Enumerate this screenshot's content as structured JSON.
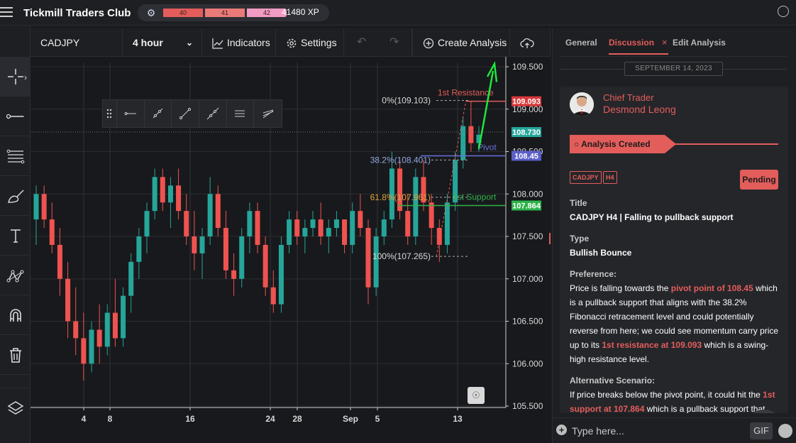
{
  "app": {
    "title": "Tickmill Traders Club",
    "xp_levels": [
      "40",
      "41",
      "42"
    ],
    "xp_total": "41480 XP"
  },
  "toolbar": {
    "symbol": "CADJPY",
    "interval": "4 hour",
    "indicators": "Indicators",
    "settings": "Settings",
    "create_analysis": "Create Analysis",
    "upload": "Up"
  },
  "left_tools": [
    "crosshair-icon",
    "trendline-icon",
    "fib-lines-icon",
    "brush-icon",
    "text-icon",
    "pattern-icon",
    "magnet-icon",
    "trash-icon",
    "layers-icon"
  ],
  "chart_data": {
    "type": "candlestick",
    "symbol": "CADJPY",
    "interval": "4 hour",
    "y_ticks": [
      "109.500",
      "109.000",
      "108.500",
      "108.000",
      "107.500",
      "107.000",
      "106.500",
      "106.000",
      "105.500"
    ],
    "ylim": [
      105.5,
      109.5
    ],
    "x_ticks": [
      "4",
      "8",
      "16",
      "24",
      "28",
      "Sep",
      "5",
      "13"
    ],
    "price_badges": [
      {
        "label": "109.093",
        "value": 109.093,
        "color": "#d9383a"
      },
      {
        "label": "108.730",
        "value": 108.73,
        "color": "#26a69a"
      },
      {
        "label": "108.45",
        "value": 108.45,
        "color": "#5b5fc7"
      },
      {
        "label": "107.864",
        "value": 107.864,
        "color": "#2db34a"
      }
    ],
    "annotations": {
      "resistance": {
        "label": "1st Resistance",
        "value": 109.093,
        "color": "#e35d5b"
      },
      "pivot": {
        "label": "Pivot",
        "value": 108.45,
        "color": "#6b6fe0"
      },
      "support": {
        "label": "1st Support",
        "value": 107.864,
        "color": "#2db34a"
      }
    },
    "fib_levels": [
      {
        "label": "0%(109.103)",
        "value": 109.103
      },
      {
        "label": "38.2%(108.401)",
        "value": 108.401
      },
      {
        "label": "61.8%(107.961)",
        "value": 107.961
      },
      {
        "label": "100%(107.265)",
        "value": 107.265
      }
    ],
    "candles": [
      {
        "o": 107.7,
        "h": 108.1,
        "l": 107.4,
        "c": 108.0
      },
      {
        "o": 108.0,
        "h": 108.1,
        "l": 107.6,
        "c": 107.7
      },
      {
        "o": 107.7,
        "h": 107.9,
        "l": 107.3,
        "c": 107.4
      },
      {
        "o": 107.4,
        "h": 107.6,
        "l": 106.8,
        "c": 107.0
      },
      {
        "o": 107.0,
        "h": 107.2,
        "l": 106.3,
        "c": 106.5
      },
      {
        "o": 106.5,
        "h": 106.9,
        "l": 106.1,
        "c": 106.3
      },
      {
        "o": 106.3,
        "h": 106.6,
        "l": 105.8,
        "c": 106.0
      },
      {
        "o": 106.0,
        "h": 106.5,
        "l": 105.9,
        "c": 106.4
      },
      {
        "o": 106.4,
        "h": 106.7,
        "l": 106.0,
        "c": 106.2
      },
      {
        "o": 106.2,
        "h": 106.7,
        "l": 106.1,
        "c": 106.6
      },
      {
        "o": 106.6,
        "h": 107.0,
        "l": 106.2,
        "c": 106.3
      },
      {
        "o": 106.3,
        "h": 106.9,
        "l": 106.2,
        "c": 106.8
      },
      {
        "o": 106.8,
        "h": 107.3,
        "l": 106.6,
        "c": 107.2
      },
      {
        "o": 107.2,
        "h": 107.6,
        "l": 107.0,
        "c": 107.5
      },
      {
        "o": 107.5,
        "h": 107.9,
        "l": 107.3,
        "c": 107.8
      },
      {
        "o": 107.8,
        "h": 108.3,
        "l": 107.7,
        "c": 108.2
      },
      {
        "o": 108.2,
        "h": 108.3,
        "l": 107.8,
        "c": 107.9
      },
      {
        "o": 107.9,
        "h": 108.2,
        "l": 107.6,
        "c": 108.1
      },
      {
        "o": 108.1,
        "h": 108.3,
        "l": 107.7,
        "c": 107.8
      },
      {
        "o": 107.8,
        "h": 108.0,
        "l": 107.4,
        "c": 107.5
      },
      {
        "o": 107.5,
        "h": 107.8,
        "l": 107.1,
        "c": 107.3
      },
      {
        "o": 107.3,
        "h": 107.6,
        "l": 107.0,
        "c": 107.5
      },
      {
        "o": 107.5,
        "h": 108.2,
        "l": 107.4,
        "c": 108.0
      },
      {
        "o": 108.0,
        "h": 108.1,
        "l": 107.5,
        "c": 107.6
      },
      {
        "o": 107.6,
        "h": 107.8,
        "l": 107.0,
        "c": 107.1
      },
      {
        "o": 107.1,
        "h": 107.3,
        "l": 106.8,
        "c": 107.0
      },
      {
        "o": 107.0,
        "h": 107.6,
        "l": 106.9,
        "c": 107.5
      },
      {
        "o": 107.5,
        "h": 107.9,
        "l": 107.3,
        "c": 107.8
      },
      {
        "o": 107.8,
        "h": 107.9,
        "l": 107.3,
        "c": 107.4
      },
      {
        "o": 107.4,
        "h": 107.5,
        "l": 106.8,
        "c": 106.9
      },
      {
        "o": 106.9,
        "h": 107.1,
        "l": 106.6,
        "c": 106.7
      },
      {
        "o": 106.7,
        "h": 107.5,
        "l": 106.6,
        "c": 107.4
      },
      {
        "o": 107.4,
        "h": 107.8,
        "l": 107.3,
        "c": 107.7
      },
      {
        "o": 107.7,
        "h": 107.8,
        "l": 107.4,
        "c": 107.5
      },
      {
        "o": 107.5,
        "h": 107.7,
        "l": 107.3,
        "c": 107.6
      },
      {
        "o": 107.6,
        "h": 107.8,
        "l": 107.5,
        "c": 107.7
      },
      {
        "o": 107.7,
        "h": 107.9,
        "l": 107.4,
        "c": 107.5
      },
      {
        "o": 107.5,
        "h": 107.7,
        "l": 107.3,
        "c": 107.6
      },
      {
        "o": 107.6,
        "h": 107.8,
        "l": 107.5,
        "c": 107.7
      },
      {
        "o": 107.7,
        "h": 107.7,
        "l": 107.3,
        "c": 107.4
      },
      {
        "o": 107.4,
        "h": 107.9,
        "l": 107.3,
        "c": 107.8
      },
      {
        "o": 107.8,
        "h": 108.0,
        "l": 107.5,
        "c": 107.6
      },
      {
        "o": 107.6,
        "h": 107.7,
        "l": 106.7,
        "c": 106.9
      },
      {
        "o": 106.9,
        "h": 107.6,
        "l": 106.8,
        "c": 107.5
      },
      {
        "o": 107.5,
        "h": 107.8,
        "l": 107.4,
        "c": 107.7
      },
      {
        "o": 107.7,
        "h": 108.5,
        "l": 107.6,
        "c": 108.3
      },
      {
        "o": 108.3,
        "h": 108.4,
        "l": 107.7,
        "c": 107.8
      },
      {
        "o": 107.8,
        "h": 108.0,
        "l": 107.4,
        "c": 107.5
      },
      {
        "o": 107.5,
        "h": 108.3,
        "l": 107.4,
        "c": 108.2
      },
      {
        "o": 108.2,
        "h": 108.4,
        "l": 107.8,
        "c": 107.9
      },
      {
        "o": 107.9,
        "h": 108.0,
        "l": 107.4,
        "c": 107.6
      },
      {
        "o": 107.6,
        "h": 107.7,
        "l": 107.2,
        "c": 107.4
      },
      {
        "o": 107.4,
        "h": 108.0,
        "l": 107.3,
        "c": 107.9
      },
      {
        "o": 107.9,
        "h": 108.5,
        "l": 107.8,
        "c": 108.4
      },
      {
        "o": 108.4,
        "h": 108.9,
        "l": 108.3,
        "c": 108.8
      },
      {
        "o": 108.8,
        "h": 109.1,
        "l": 108.5,
        "c": 108.6
      },
      {
        "o": 108.6,
        "h": 108.8,
        "l": 108.5,
        "c": 108.7
      }
    ]
  },
  "right_panel": {
    "tabs": {
      "general": "General",
      "discussion": "Discussion",
      "edit": "Edit Analysis"
    },
    "tab_close": "×",
    "date": "SEPTEMBER 14, 2023",
    "author_role": "Chief Trader",
    "author_name": "Desmond Leong",
    "banner": "Analysis Created",
    "tags": [
      "CADJPY",
      "H4"
    ],
    "status": "Pending",
    "title_label": "Title",
    "title_value": "CADJPY H4 | Falling to pullback support",
    "type_label": "Type",
    "type_value": "Bullish Bounce",
    "preference_label": "Preference:",
    "preference_p1": "Price is falling towards the ",
    "preference_hl1": "pivot point of 108.45",
    "preference_p2": " which is a pullback support that aligns with the 38.2% Fibonacci retracement level and could potentially reverse from here; we could see momentum carry price up to its ",
    "preference_hl2": "1st resistance at 109.093",
    "preference_p3": " which is a swing-high resistance level.",
    "alt_label": "Alternative Scenario:",
    "alt_p1": "If price breaks below the pivot point, it could hit the ",
    "alt_hl1": "1st support at 107.864",
    "alt_p2": " which is a pullback support that",
    "input_placeholder": "Type here...",
    "gif": "GIF"
  }
}
